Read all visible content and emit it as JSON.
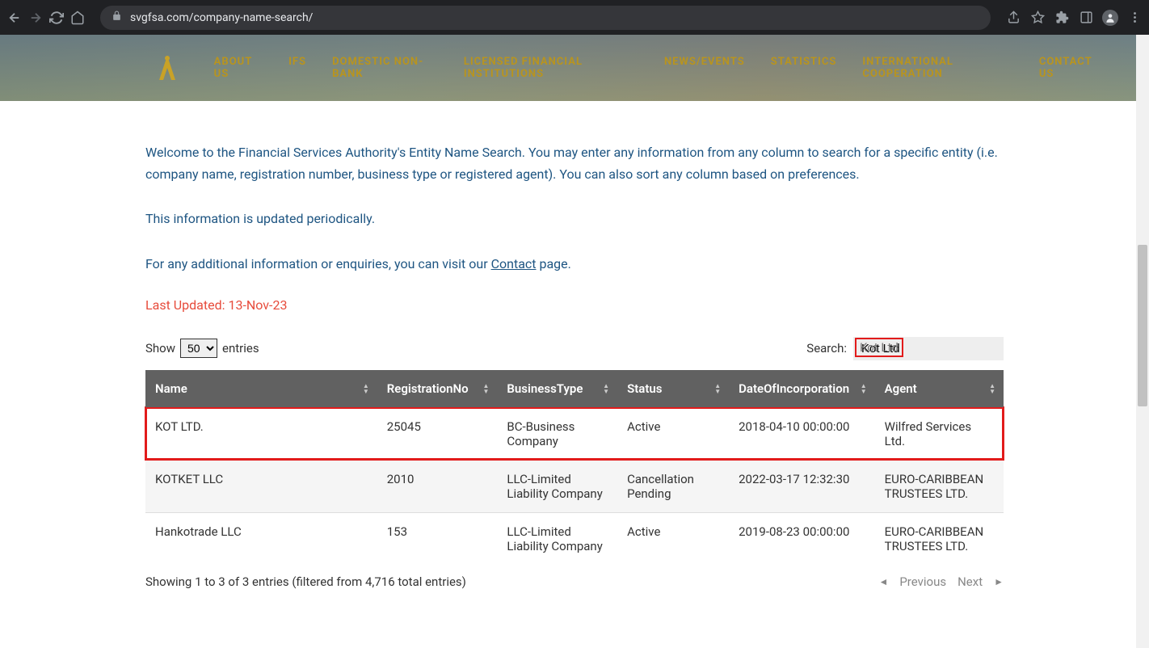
{
  "browser": {
    "url": "svgfsa.com/company-name-search/"
  },
  "nav": {
    "items": [
      "ABOUT US",
      "IFS",
      "DOMESTIC NON-BANK",
      "LICENSED FINANCIAL INSTITUTIONS",
      "NEWS/EVENTS",
      "STATISTICS",
      "INTERNATIONAL COOPERATION",
      "CONTACT US"
    ]
  },
  "intro": {
    "p1": "Welcome to the Financial Services Authority's Entity Name Search. You may enter any information from any column to search for a specific entity (i.e. company name, registration number, business type or registered agent). You can also sort any column based on preferences.",
    "p2": "This information is updated periodically.",
    "p3_prefix": "For any additional information or enquiries, you can visit our ",
    "p3_link": "Contact",
    "p3_suffix": " page."
  },
  "last_updated": "Last Updated:  13-Nov-23",
  "controls": {
    "show_label": "Show",
    "entries_label": "entries",
    "entries_value": "50",
    "search_label": "Search:",
    "search_value": "Kot Ltd"
  },
  "table": {
    "headers": [
      "Name",
      "RegistrationNo",
      "BusinessType",
      "Status",
      "DateOfIncorporation",
      "Agent"
    ],
    "rows": [
      {
        "name": "KOT LTD.",
        "reg": "25045",
        "type": "BC-Business Company",
        "status": "Active",
        "date": "2018-04-10 00:00:00",
        "agent": "Wilfred Services Ltd.",
        "highlight": true
      },
      {
        "name": "KOTKET LLC",
        "reg": "2010",
        "type": "LLC-Limited Liability Company",
        "status": "Cancellation Pending",
        "date": "2022-03-17 12:32:30",
        "agent": "EURO-CARIBBEAN TRUSTEES LTD.",
        "highlight": false
      },
      {
        "name": "Hankotrade LLC",
        "reg": "153",
        "type": "LLC-Limited Liability Company",
        "status": "Active",
        "date": "2019-08-23 00:00:00",
        "agent": "EURO-CARIBBEAN TRUSTEES LTD.",
        "highlight": false
      }
    ]
  },
  "footer": {
    "info": "Showing 1 to 3 of 3 entries (filtered from 4,716 total entries)",
    "previous": "Previous",
    "next": "Next"
  }
}
